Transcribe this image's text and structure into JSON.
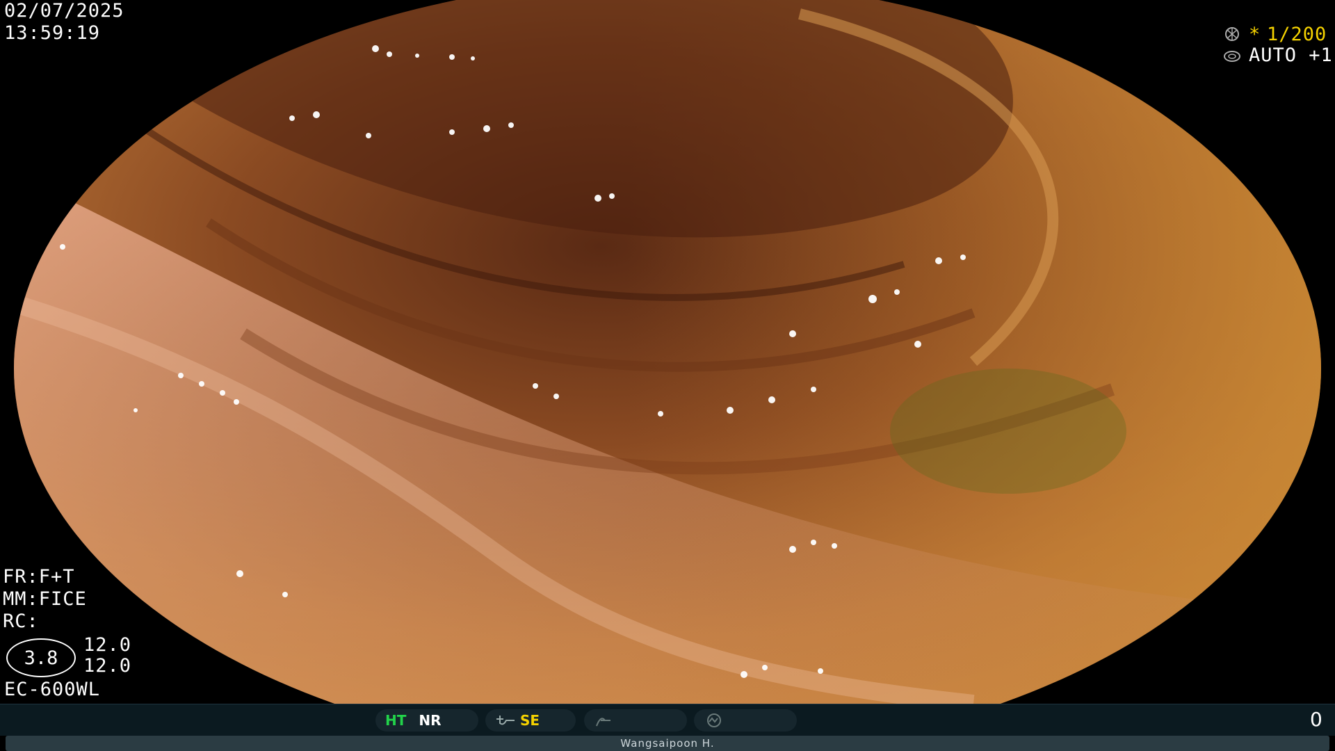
{
  "timestamp": {
    "date": "02/07/2025",
    "time": "13:59:19"
  },
  "exposure": {
    "shutter": "1/200",
    "shutter_prefix": "*",
    "mode": "AUTO +1"
  },
  "settings": {
    "fr": "FR:F+T",
    "mm": "MM:FICE",
    "rc": "RC:"
  },
  "magnification": {
    "ratio": "3.8",
    "value_top": "12.0",
    "value_bottom": "12.0"
  },
  "scope_model": "EC-600WL",
  "status_bar": {
    "ht": "HT",
    "nr": "NR",
    "se": "SE",
    "counter": "0"
  },
  "operator": "Wangsaipoon H.",
  "colors": {
    "accent_yellow": "#f5d200",
    "accent_green": "#22d34a",
    "statusbar_bg": "#0b1a20"
  }
}
